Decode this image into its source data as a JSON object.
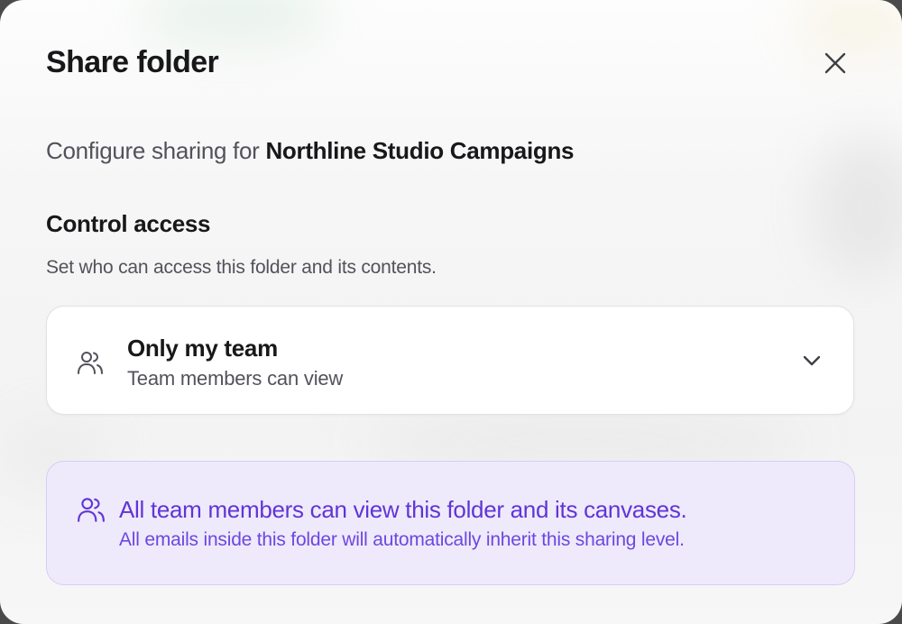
{
  "dialog": {
    "title": "Share folder",
    "close_icon": "close-icon",
    "subtitle_prefix": "Configure sharing for",
    "folder_name": "Northline Studio Campaigns"
  },
  "access": {
    "heading": "Control access",
    "description": "Set who can access this folder and its contents.",
    "select": {
      "icon": "team-icon",
      "selected_label": "Only my team",
      "selected_description": "Team members can view",
      "chevron_icon": "chevron-down-icon"
    }
  },
  "notice": {
    "icon": "team-icon",
    "title": "All team members can view this folder and its canvases.",
    "message": "All emails inside this folder will automatically inherit this sharing level."
  },
  "colors": {
    "text_primary": "#18181b",
    "text_secondary": "#52525b",
    "accent": "#6035d6",
    "notice_bg": "#efeafb",
    "notice_border": "#d8cdf5"
  }
}
